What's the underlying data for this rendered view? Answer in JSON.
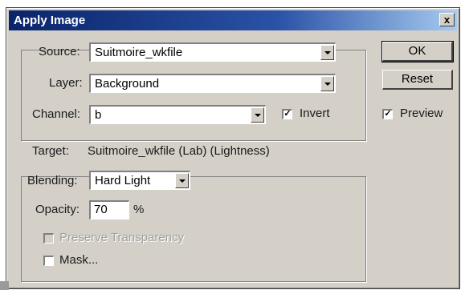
{
  "window": {
    "title": "Apply Image",
    "close_glyph": "x"
  },
  "source": {
    "label": "Source:",
    "value": "Suitmoire_wkfile"
  },
  "layer": {
    "label": "Layer:",
    "value": "Background"
  },
  "channel": {
    "label": "Channel:",
    "value": "b"
  },
  "invert": {
    "label": "Invert",
    "checked": true
  },
  "buttons": {
    "ok": "OK",
    "reset": "Reset"
  },
  "preview": {
    "label": "Preview",
    "checked": true
  },
  "target": {
    "label": "Target:",
    "value": "Suitmoire_wkfile (Lab) (Lightness)"
  },
  "blending": {
    "label": "Blending:",
    "value": "Hard Light"
  },
  "opacity": {
    "label": "Opacity:",
    "value": "70",
    "unit": "%"
  },
  "preserve_transparency": {
    "label": "Preserve Transparency",
    "checked": false,
    "enabled": false
  },
  "mask": {
    "label": "Mask...",
    "checked": false
  },
  "check_glyph": "✓",
  "colors": {
    "dialog_bg": "#d4d0c8",
    "titlebar": "#0a246a"
  }
}
